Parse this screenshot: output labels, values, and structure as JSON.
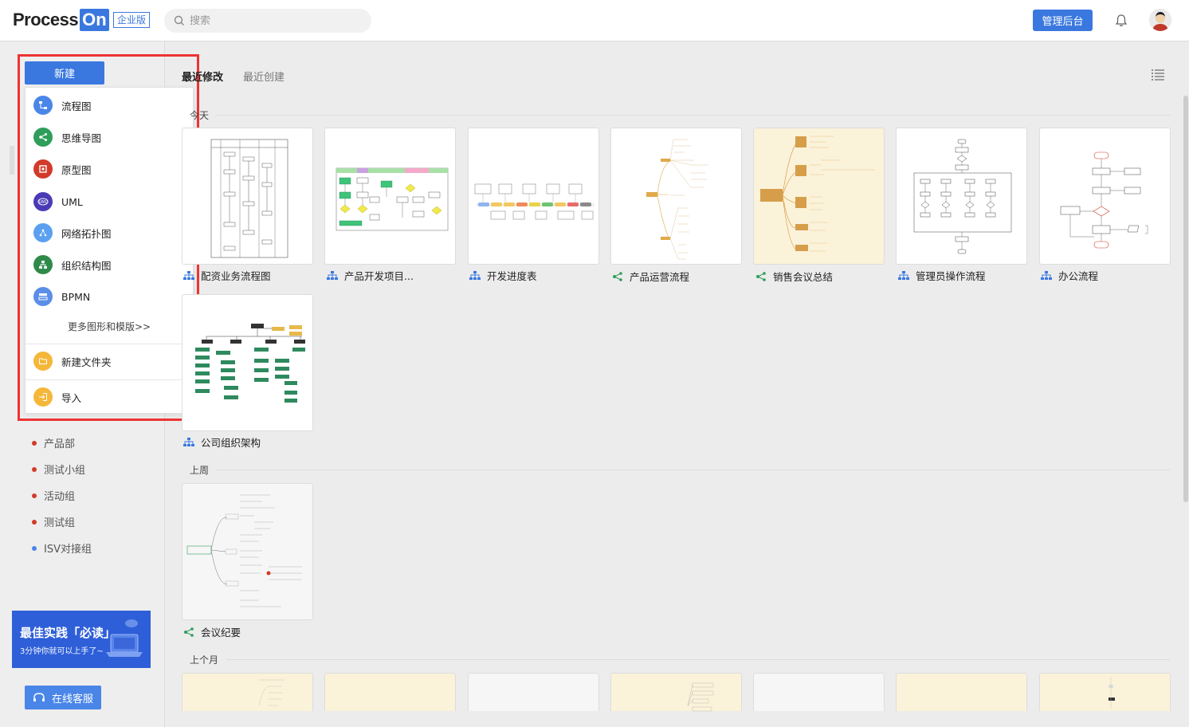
{
  "header": {
    "logo_text": "Process",
    "logo_on": "On",
    "edition": "企业版",
    "search_placeholder": "搜索",
    "admin_button": "管理后台"
  },
  "sidebar": {
    "new_button": "新建",
    "menu": [
      {
        "label": "流程图",
        "icon": "flowchart-icon",
        "color": "#4a86e8"
      },
      {
        "label": "思维导图",
        "icon": "mindmap-icon",
        "color": "#2f9e5a"
      },
      {
        "label": "原型图",
        "icon": "prototype-icon",
        "color": "#d23a2a"
      },
      {
        "label": "UML",
        "icon": "uml-icon",
        "color": "#4a3bb5"
      },
      {
        "label": "网络拓扑图",
        "icon": "network-icon",
        "color": "#5ba0f0"
      },
      {
        "label": "组织结构图",
        "icon": "org-icon",
        "color": "#2f8a4a"
      },
      {
        "label": "BPMN",
        "icon": "bpmn-icon",
        "color": "#5b8ee8"
      }
    ],
    "more_link": "更多图形和模版>>",
    "new_folder": "新建文件夹",
    "import": "导入",
    "teams": [
      {
        "label": "产品部",
        "color": "#d23a2a"
      },
      {
        "label": "测试小组",
        "color": "#d23a2a"
      },
      {
        "label": "活动组",
        "color": "#d23a2a"
      },
      {
        "label": "测试组",
        "color": "#d23a2a"
      },
      {
        "label": "ISV对接组",
        "color": "#4a86e8"
      }
    ],
    "banner_title": "最佳实践「必读」",
    "banner_sub": "3分钟你就可以上手了~",
    "service_button": "在线客服"
  },
  "main": {
    "tabs": [
      "最近修改",
      "最近创建"
    ],
    "sections": {
      "today": "今天",
      "last_week": "上周",
      "last_month": "上个月"
    },
    "files_today": [
      {
        "name": "配资业务流程图",
        "type": "flowchart"
      },
      {
        "name": "产品开发项目...",
        "type": "flowchart"
      },
      {
        "name": "开发进度表",
        "type": "flowchart"
      },
      {
        "name": "产品运营流程",
        "type": "mindmap"
      },
      {
        "name": "销售会议总结",
        "type": "mindmap"
      },
      {
        "name": "管理员操作流程",
        "type": "flowchart"
      },
      {
        "name": "办公流程",
        "type": "flowchart"
      },
      {
        "name": "公司组织架构",
        "type": "flowchart"
      }
    ],
    "files_last_week": [
      {
        "name": "会议纪要",
        "type": "mindmap"
      }
    ]
  }
}
